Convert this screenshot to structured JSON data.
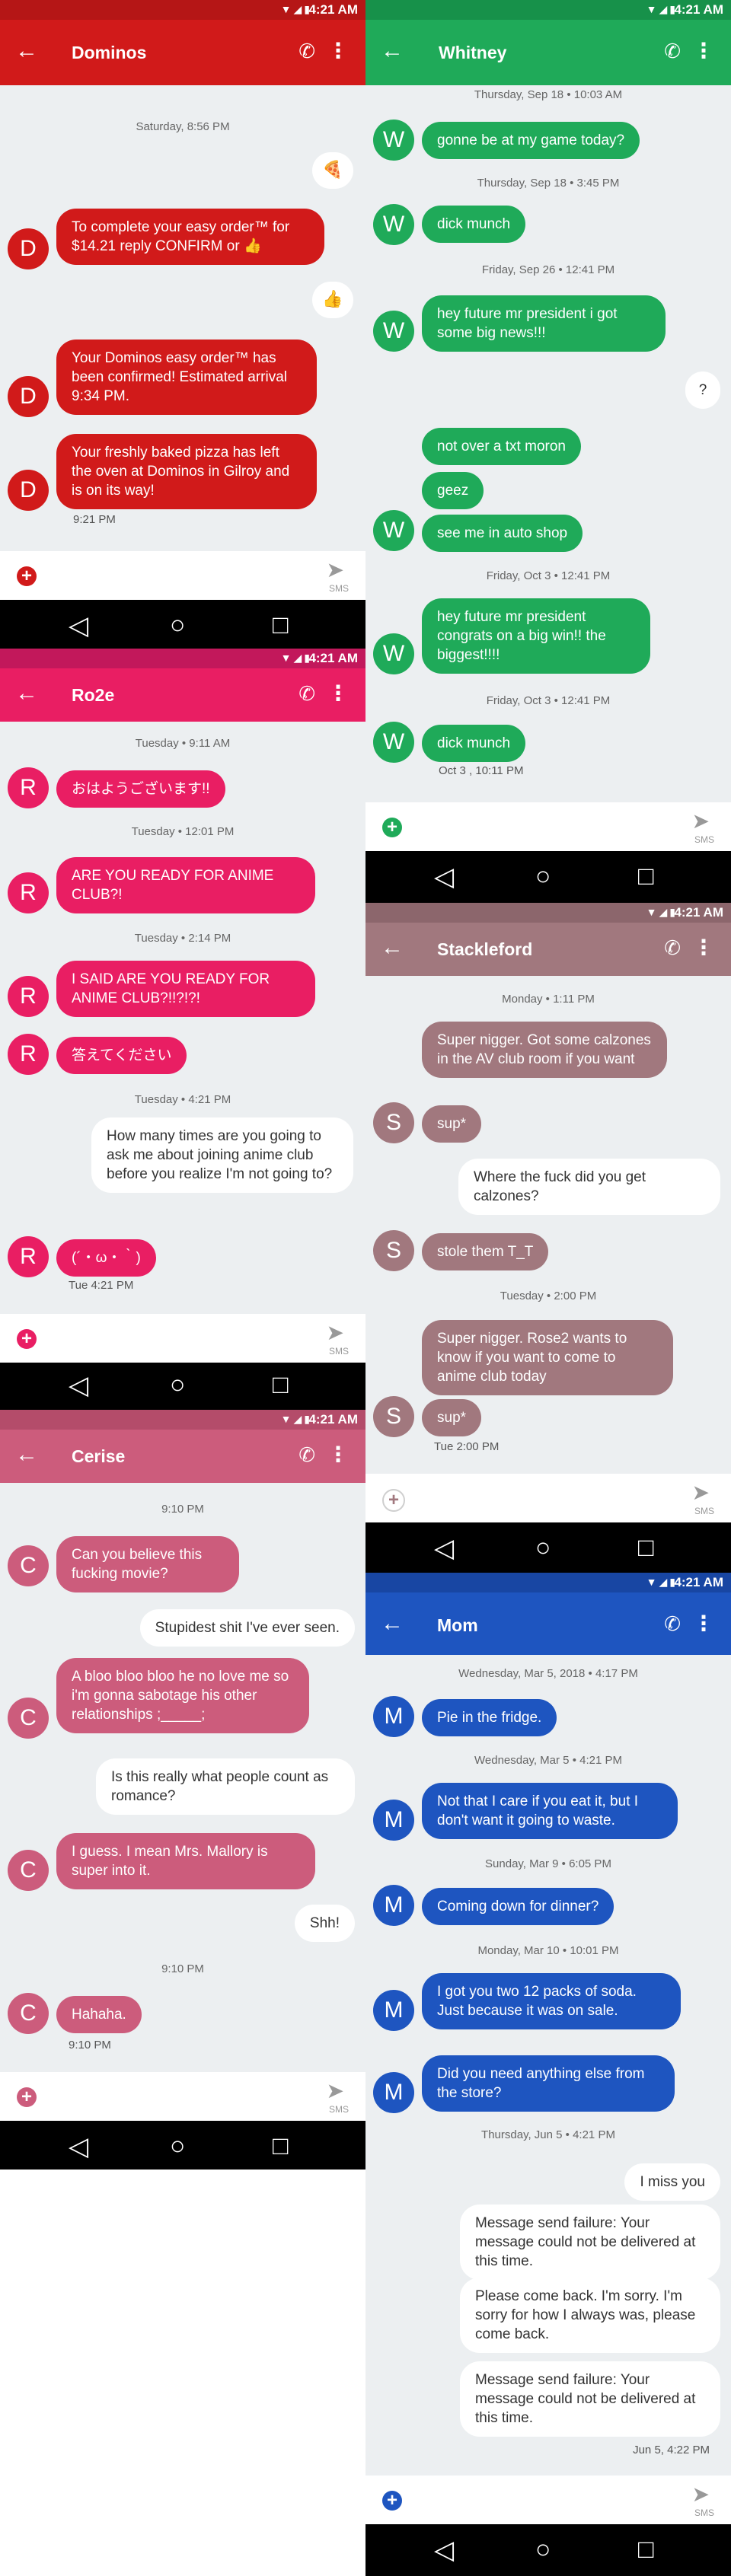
{
  "status_time": "4:21 AM",
  "send_label": "SMS",
  "panels": {
    "dominos": {
      "contact": "Dominos",
      "initial": "D",
      "color": "#d11a1a",
      "bar": "#b51616",
      "stamps": [
        "Saturday, 8:56 PM"
      ],
      "messages": [
        {
          "text": "To complete your easy order™ for $14.21 reply CONFIRM or 👍"
        },
        {
          "text": "Your Dominos easy order™ has been confirmed! Estimated arrival 9:34 PM."
        },
        {
          "text": "Your freshly baked pizza has left the oven at Dominos in Gilroy and is on its way!"
        }
      ],
      "emoji_pizza": "🍕",
      "emoji_thumb": "👍",
      "footer": "9:21 PM"
    },
    "whitney": {
      "contact": "Whitney",
      "initial": "W",
      "color": "#1faa59",
      "bar": "#17914a",
      "stamps": [
        "Thursday, Sep 18 • 10:03 AM",
        "Thursday, Sep 18 • 3:45 PM",
        "Friday, Sep 26 • 12:41 PM",
        "Friday, Oct 3 • 12:41 PM",
        "Friday, Oct 3 • 12:41 PM"
      ],
      "messages": [
        {
          "text": "gonne be at my game today?"
        },
        {
          "text": "dick munch"
        },
        {
          "text": "hey future mr president i got some big news!!!"
        },
        {
          "text": "?"
        },
        {
          "text": "not over a txt moron"
        },
        {
          "text": "geez"
        },
        {
          "text": "see me in auto shop"
        },
        {
          "text": "hey future mr president congrats on a big win!! the biggest!!!!"
        },
        {
          "text": "dick munch"
        }
      ],
      "footer": "Oct 3 , 10:11 PM"
    },
    "ro2e": {
      "contact": "Ro2e",
      "initial": "R",
      "color": "#e91e63",
      "bar": "#c2185b",
      "stamps": [
        "Tuesday • 9:11 AM",
        "Tuesday • 12:01 PM",
        "Tuesday • 2:14 PM",
        "Tuesday • 4:21 PM"
      ],
      "messages": [
        {
          "text": "おはようございます!!"
        },
        {
          "text": "ARE YOU READY FOR ANIME CLUB?!"
        },
        {
          "text": "I SAID ARE YOU READY FOR ANIME CLUB?!!?!?!"
        },
        {
          "text": "答えてください"
        },
        {
          "text": "How many times are you going to ask me about joining anime club before you realize I'm not going to?"
        },
        {
          "text": "(´・ω・｀)"
        }
      ],
      "footer": "Tue 4:21 PM"
    },
    "stackleford": {
      "contact": "Stackleford",
      "initial": "S",
      "color": "#a1787e",
      "bar": "#8c666c",
      "stamps": [
        "Monday • 1:11 PM",
        "Tuesday • 2:00 PM"
      ],
      "messages": [
        {
          "text": "Super nigger. Got some calzones in the AV club room if you want"
        },
        {
          "text": "sup*"
        },
        {
          "text": "Where the fuck did you get calzones?"
        },
        {
          "text": "stole them T_T"
        },
        {
          "text": "Super nigger. Rose2 wants to know if you want to come to anime club today"
        },
        {
          "text": "sup*"
        }
      ],
      "footer": "Tue 2:00 PM"
    },
    "cerise": {
      "contact": "Cerise",
      "initial": "C",
      "color": "#cc5c7c",
      "bar": "#b44c6a",
      "stamps": [
        "9:10 PM",
        "9:10 PM"
      ],
      "messages": [
        {
          "text": "Can you believe this fucking movie?"
        },
        {
          "text": "Stupidest shit I've ever seen."
        },
        {
          "text": "A bloo bloo bloo he no love me so i'm gonna sabotage his other relationships ;_____;"
        },
        {
          "text": "Is this really what people count as romance?"
        },
        {
          "text": "I guess. I mean Mrs. Mallory is super into it."
        },
        {
          "text": "Shh!"
        },
        {
          "text": "Hahaha."
        }
      ],
      "footer": "9:10 PM"
    },
    "mom": {
      "contact": "Mom",
      "initial": "M",
      "color": "#1e55c0",
      "bar": "#1846a3",
      "stamps": [
        "Wednesday, Mar 5, 2018 • 4:17 PM",
        "Wednesday, Mar 5 • 4:21 PM",
        "Sunday, Mar 9 • 6:05 PM",
        "Monday, Mar 10 • 10:01 PM",
        "Thursday, Jun 5 • 4:21 PM"
      ],
      "messages": [
        {
          "text": "Pie in the fridge."
        },
        {
          "text": "Not that I care if you eat it, but I don't want it going to waste."
        },
        {
          "text": "Coming down for dinner?"
        },
        {
          "text": "I got you two 12 packs of soda. Just because it was on sale."
        },
        {
          "text": "Did you need anything else from the store?"
        },
        {
          "text": "I miss you"
        },
        {
          "text": "Message send failure: Your message could not be delivered at this time."
        },
        {
          "text": "Please come back. I'm sorry. I'm sorry for how I always was, please come back."
        },
        {
          "text": "Message send failure: Your message could not be delivered at this time."
        }
      ],
      "footer": "Jun 5, 4:22 PM"
    }
  }
}
